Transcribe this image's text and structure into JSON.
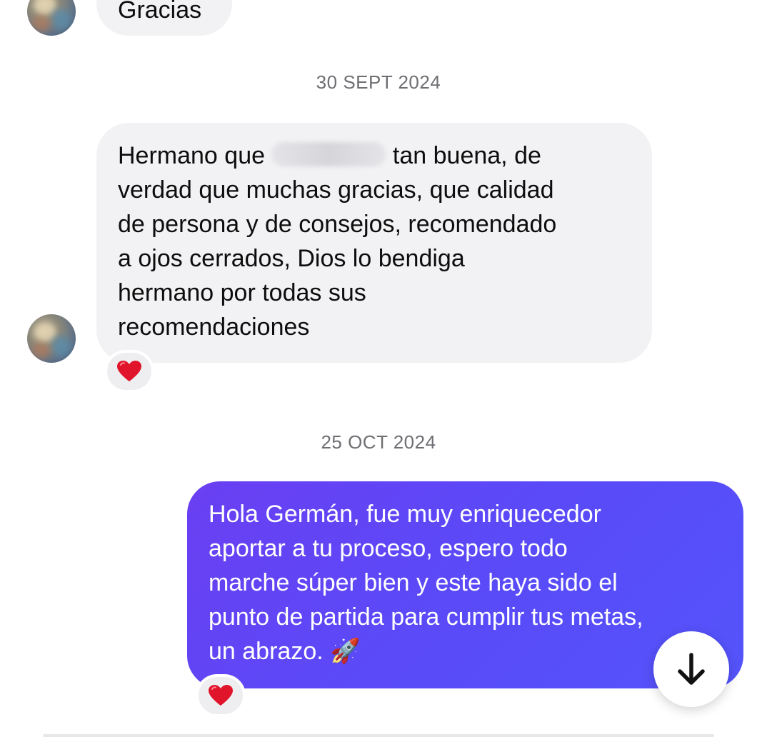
{
  "messages": {
    "top_reply": "Gracias",
    "date_1": "30 SEPT 2024",
    "incoming": {
      "line1_start": "Hermano que",
      "line1_end": "tan buena, de",
      "line2": "verdad que muchas gracias, que calidad",
      "line3": "de persona y de consejos, recomendado",
      "line4": "a ojos cerrados, Dios lo bendiga",
      "line5": "hermano por todas sus",
      "line6": "recomendaciones",
      "reaction": "❤️"
    },
    "date_2": "25 OCT 2024",
    "outgoing": {
      "line1": "Hola Germán, fue muy enriquecedor",
      "line2": "aportar a tu proceso, espero todo",
      "line3": "marche súper bien y este haya sido el",
      "line4": "punto de partida para cumplir tus metas,",
      "line5": "un abrazo. 🚀",
      "reaction": "❤️"
    }
  },
  "icons": {
    "scroll_down": "arrow-down-icon",
    "reaction": "heart-icon"
  },
  "colors": {
    "incoming_bubble": "#f2f2f4",
    "outgoing_bubble": "#5a4af8",
    "date_text": "#6e6e73",
    "reaction_heart": "#e0142b"
  }
}
